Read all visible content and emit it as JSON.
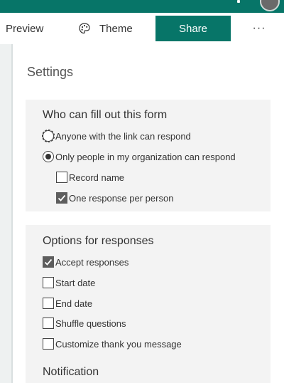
{
  "toolbar": {
    "preview_label": "Preview",
    "theme_label": "Theme",
    "share_label": "Share",
    "more_label": "···"
  },
  "settings": {
    "title": "Settings",
    "who_section": {
      "title": "Who can fill out this form",
      "options": [
        {
          "label": "Anyone with the link can respond",
          "selected": false
        },
        {
          "label": "Only people in my organization can respond",
          "selected": true
        }
      ],
      "sub_options": [
        {
          "label": "Record name",
          "checked": false
        },
        {
          "label": "One response per person",
          "checked": true
        }
      ]
    },
    "responses_section": {
      "title": "Options for responses",
      "options": [
        {
          "label": "Accept responses",
          "checked": true
        },
        {
          "label": "Start date",
          "checked": false
        },
        {
          "label": "End date",
          "checked": false
        },
        {
          "label": "Shuffle questions",
          "checked": false
        },
        {
          "label": "Customize thank you message",
          "checked": false
        }
      ],
      "notification_title": "Notification"
    }
  },
  "colors": {
    "brand_green": "#077568",
    "section_bg": "#f3f3f3",
    "canvas_bg": "#eef1f1"
  }
}
